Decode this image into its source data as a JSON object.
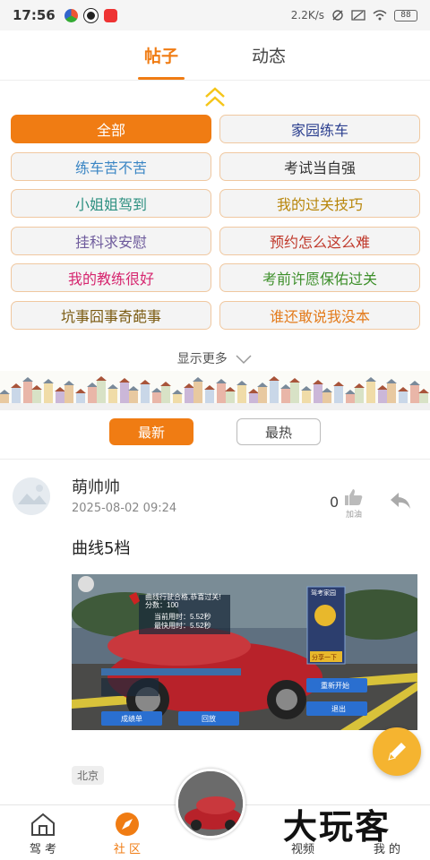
{
  "status_bar": {
    "time": "17:56",
    "net_speed": "2.2K/s",
    "battery": "88"
  },
  "tabs": [
    {
      "label": "帖子",
      "active": true
    },
    {
      "label": "动态",
      "active": false
    }
  ],
  "categories": [
    {
      "label": "全部",
      "color": "#ffffff",
      "active": true
    },
    {
      "label": "家园练车",
      "color": "#2b3f8f"
    },
    {
      "label": "练车苦不苦",
      "color": "#3b86c4"
    },
    {
      "label": "考试当自强",
      "color": "#333333"
    },
    {
      "label": "小姐姐驾到",
      "color": "#2c8f80"
    },
    {
      "label": "我的过关技巧",
      "color": "#b8860b"
    },
    {
      "label": "挂科求安慰",
      "color": "#6e5b9c"
    },
    {
      "label": "预约怎么这么难",
      "color": "#c0392b"
    },
    {
      "label": "我的教练很好",
      "color": "#d6266f"
    },
    {
      "label": "考前许愿保佑过关",
      "color": "#3d8f2a"
    },
    {
      "label": "坑事囧事奇葩事",
      "color": "#7a5a10"
    },
    {
      "label": "谁还敢说我没本",
      "color": "#e37b1c"
    }
  ],
  "show_more": "显示更多",
  "sort": {
    "latest": "最新",
    "hottest": "最热"
  },
  "post": {
    "author": "萌帅帅",
    "time": "2025-08-02 09:24",
    "likes": "0",
    "like_label": "加油",
    "title": "曲线5档",
    "location": "北京",
    "image": {
      "result_line": "曲线行驶合格,恭喜过关!",
      "score_line": "分数：100",
      "time_used": "当前用时：5.52秒",
      "best_time": "最快用时：5.52秒",
      "ad_title": "驾考家园",
      "share_btn": "分享一下",
      "restart_btn": "重新开始",
      "exit_btn": "退出",
      "score_btn": "成绩单",
      "replay_btn": "回放"
    }
  },
  "bottom_nav": [
    {
      "label": "驾 考",
      "icon": "home-icon"
    },
    {
      "label": "社 区",
      "icon": "compass-icon",
      "active": true
    },
    {
      "label": "视频",
      "icon": "video-icon"
    },
    {
      "label": "我 的",
      "icon": "profile-icon"
    }
  ],
  "watermark": "大玩客",
  "colors": {
    "accent": "#f07c13",
    "fab": "#f5b430"
  }
}
